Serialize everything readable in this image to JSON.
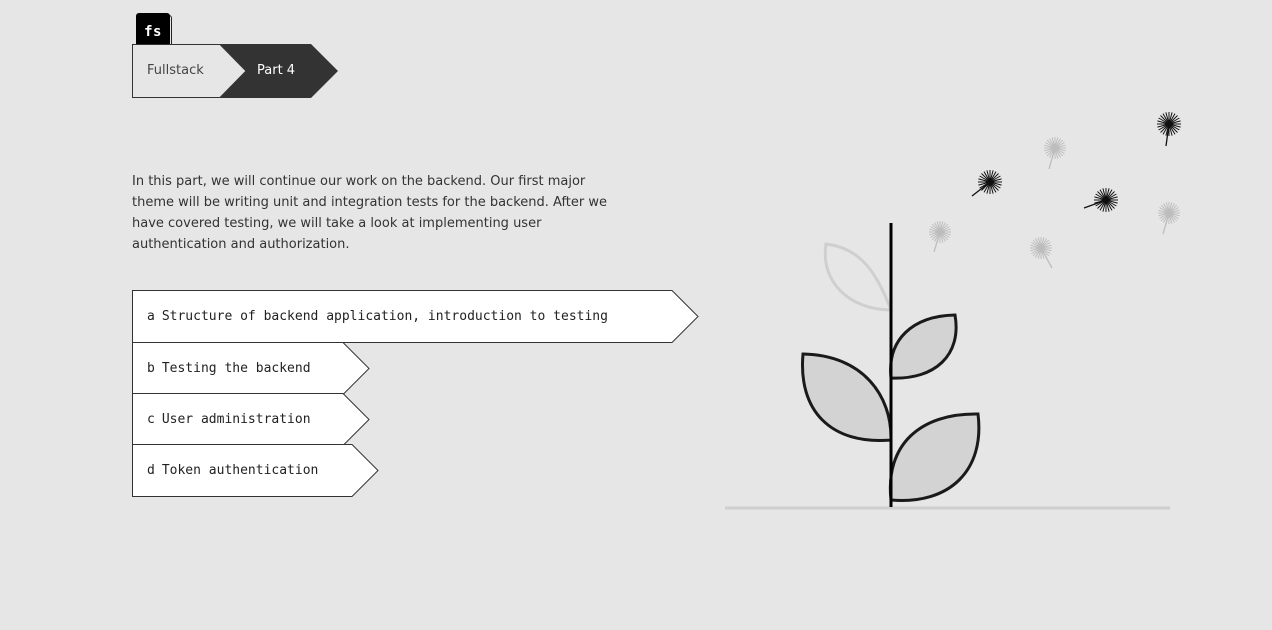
{
  "logo": {
    "text": "fs"
  },
  "breadcrumb": {
    "items": [
      {
        "label": "Fullstack"
      },
      {
        "label": "Part 4"
      }
    ]
  },
  "intro": {
    "text": "In this part, we will continue our work on the backend. Our first major theme will be writing unit and integration tests for the backend. After we have covered testing, we will take a look at implementing user authentication and authorization."
  },
  "sections": [
    {
      "letter": "a",
      "title": "Structure of backend application, introduction to testing"
    },
    {
      "letter": "b",
      "title": "Testing the backend"
    },
    {
      "letter": "c",
      "title": "User administration"
    },
    {
      "letter": "d",
      "title": "Token authentication"
    }
  ],
  "colors": {
    "background": "#e6e6e6",
    "dark": "#333333",
    "leaf_fill": "#d3d3d3",
    "white": "#ffffff"
  }
}
